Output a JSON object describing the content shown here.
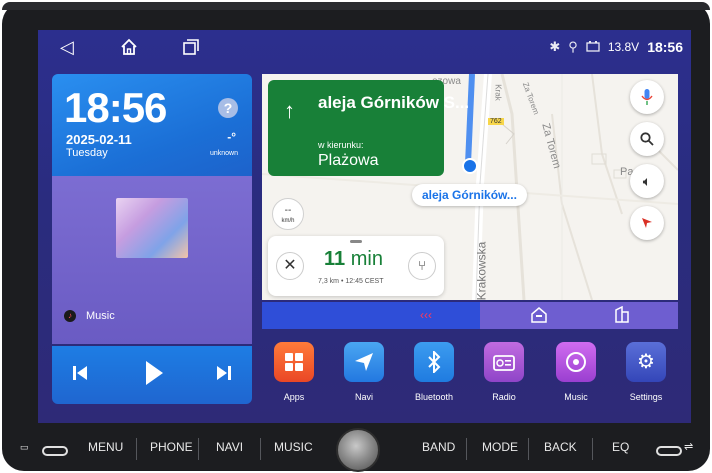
{
  "status_bar": {
    "nav_icons": [
      "back-icon",
      "home-icon",
      "recents-icon"
    ],
    "voltage": "13.8V",
    "time": "18:56"
  },
  "clock_widget": {
    "time": "18:56",
    "date": "2025-02-11",
    "day": "Tuesday",
    "weather_icon": "?",
    "temperature": "-°",
    "condition": "unknown"
  },
  "music_widget": {
    "label": "Music"
  },
  "navigation": {
    "street": "aleja Górników S...",
    "towards_label": "w kierunku:",
    "destination": "Plażowa",
    "speed_value": "--",
    "speed_unit": "km/h",
    "current_street": "aleja Górników...",
    "eta_minutes": "11",
    "eta_unit": "min",
    "eta_details": "7,3 km • 12:45 CEST",
    "map_labels": {
      "road_krakowska": "Krakowska",
      "road_za_torem": "Za Torem",
      "road_za_torem_2": "Za Torem",
      "road_number": "762",
      "partial_pat": "Pa",
      "partial_ezowa": "ezowa",
      "partial_krak": "Krak"
    }
  },
  "apps": [
    {
      "label": "Apps",
      "color": "#f15a2a"
    },
    {
      "label": "Navi",
      "color": "#2e8fe8"
    },
    {
      "label": "Bluetooth",
      "color": "#1f87e5"
    },
    {
      "label": "Radio",
      "color": "#a857d6"
    },
    {
      "label": "Music",
      "color": "#b24fd8"
    },
    {
      "label": "Settings",
      "color": "#3f58c8"
    }
  ],
  "hardware_buttons": [
    "MENU",
    "PHONE",
    "NAVI",
    "MUSIC",
    "BAND",
    "MODE",
    "BACK",
    "EQ"
  ]
}
